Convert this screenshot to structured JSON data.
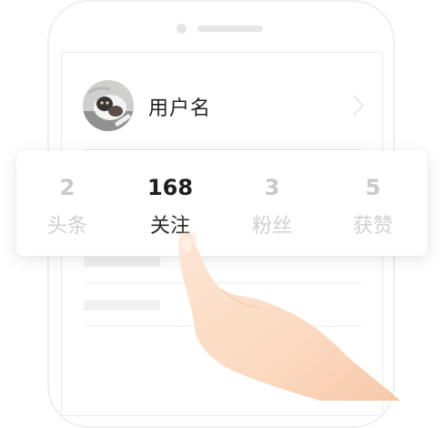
{
  "profile": {
    "username": "用户名"
  },
  "stats": [
    {
      "value": "2",
      "label": "头条",
      "active": false
    },
    {
      "value": "168",
      "label": "关注",
      "active": true
    },
    {
      "value": "3",
      "label": "粉丝",
      "active": false
    },
    {
      "value": "5",
      "label": "获赞",
      "active": false
    }
  ],
  "icons": {
    "avatar": "cat-avatar-image",
    "chevron": "chevron-right-icon",
    "pointer": "finger-tap-illustration"
  },
  "colors": {
    "active_text": "#1f1f1f",
    "inactive_text": "#c9c9c9",
    "card_background": "#ffffff"
  }
}
